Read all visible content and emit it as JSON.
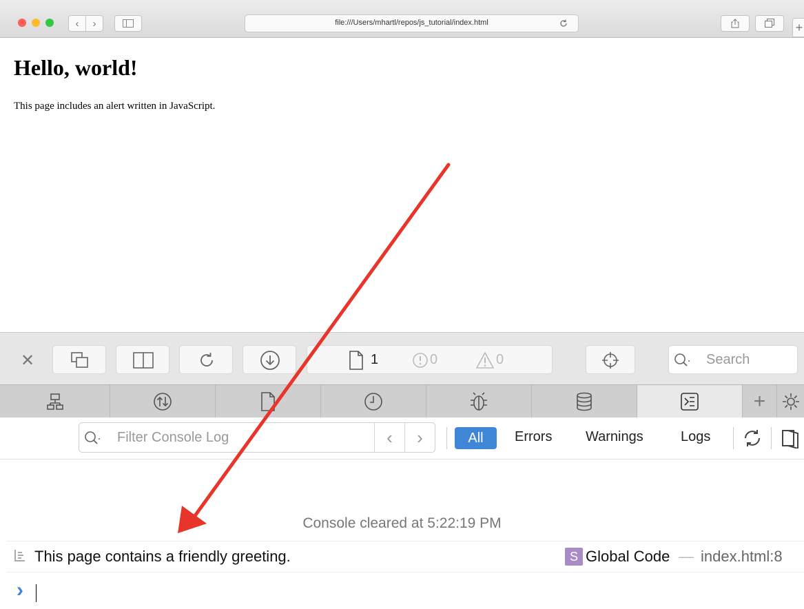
{
  "browser": {
    "url": "file:///Users/mhartl/repos/js_tutorial/index.html",
    "traffic_light_colors": [
      "#fc5f57",
      "#fdbc2e",
      "#33c748"
    ]
  },
  "page": {
    "heading": "Hello, world!",
    "paragraph": "This page includes an alert written in JavaScript."
  },
  "devtools": {
    "resource_count": "1",
    "error_count": "0",
    "warning_count": "0",
    "search_placeholder": "Search",
    "tabs": [
      "elements-icon",
      "network-icon",
      "resources-icon",
      "timelines-icon",
      "debugger-icon",
      "storage-icon",
      "console-icon"
    ],
    "filter_placeholder": "Filter Console Log",
    "filters": {
      "all": "All",
      "errors": "Errors",
      "warnings": "Warnings",
      "logs": "Logs"
    },
    "accent": "#3f86d6"
  },
  "console": {
    "cleared": "Console cleared at 5:22:19 PM",
    "message": "This page contains a friendly greeting.",
    "source_badge": "S",
    "source_function": "Global Code",
    "source_separator": "—",
    "source_location": "index.html:8",
    "prompt": "›"
  },
  "annotation": {
    "arrow_color": "#e8352b"
  }
}
